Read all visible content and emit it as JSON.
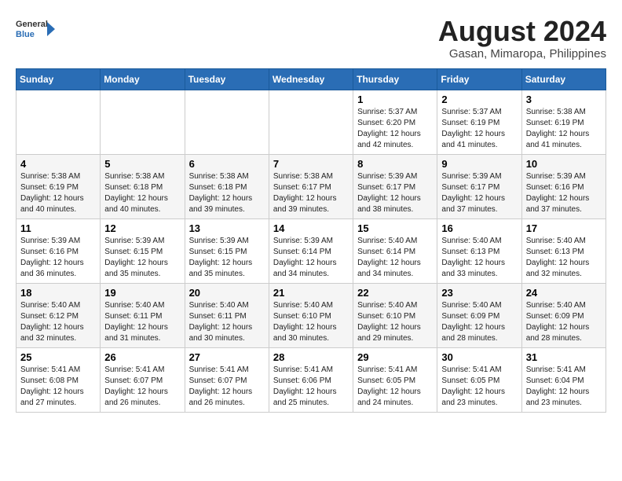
{
  "header": {
    "logo_general": "General",
    "logo_blue": "Blue",
    "month": "August 2024",
    "location": "Gasan, Mimaropa, Philippines"
  },
  "weekdays": [
    "Sunday",
    "Monday",
    "Tuesday",
    "Wednesday",
    "Thursday",
    "Friday",
    "Saturday"
  ],
  "weeks": [
    [
      {
        "day": "",
        "info": ""
      },
      {
        "day": "",
        "info": ""
      },
      {
        "day": "",
        "info": ""
      },
      {
        "day": "",
        "info": ""
      },
      {
        "day": "1",
        "info": "Sunrise: 5:37 AM\nSunset: 6:20 PM\nDaylight: 12 hours\nand 42 minutes."
      },
      {
        "day": "2",
        "info": "Sunrise: 5:37 AM\nSunset: 6:19 PM\nDaylight: 12 hours\nand 41 minutes."
      },
      {
        "day": "3",
        "info": "Sunrise: 5:38 AM\nSunset: 6:19 PM\nDaylight: 12 hours\nand 41 minutes."
      }
    ],
    [
      {
        "day": "4",
        "info": "Sunrise: 5:38 AM\nSunset: 6:19 PM\nDaylight: 12 hours\nand 40 minutes."
      },
      {
        "day": "5",
        "info": "Sunrise: 5:38 AM\nSunset: 6:18 PM\nDaylight: 12 hours\nand 40 minutes."
      },
      {
        "day": "6",
        "info": "Sunrise: 5:38 AM\nSunset: 6:18 PM\nDaylight: 12 hours\nand 39 minutes."
      },
      {
        "day": "7",
        "info": "Sunrise: 5:38 AM\nSunset: 6:17 PM\nDaylight: 12 hours\nand 39 minutes."
      },
      {
        "day": "8",
        "info": "Sunrise: 5:39 AM\nSunset: 6:17 PM\nDaylight: 12 hours\nand 38 minutes."
      },
      {
        "day": "9",
        "info": "Sunrise: 5:39 AM\nSunset: 6:17 PM\nDaylight: 12 hours\nand 37 minutes."
      },
      {
        "day": "10",
        "info": "Sunrise: 5:39 AM\nSunset: 6:16 PM\nDaylight: 12 hours\nand 37 minutes."
      }
    ],
    [
      {
        "day": "11",
        "info": "Sunrise: 5:39 AM\nSunset: 6:16 PM\nDaylight: 12 hours\nand 36 minutes."
      },
      {
        "day": "12",
        "info": "Sunrise: 5:39 AM\nSunset: 6:15 PM\nDaylight: 12 hours\nand 35 minutes."
      },
      {
        "day": "13",
        "info": "Sunrise: 5:39 AM\nSunset: 6:15 PM\nDaylight: 12 hours\nand 35 minutes."
      },
      {
        "day": "14",
        "info": "Sunrise: 5:39 AM\nSunset: 6:14 PM\nDaylight: 12 hours\nand 34 minutes."
      },
      {
        "day": "15",
        "info": "Sunrise: 5:40 AM\nSunset: 6:14 PM\nDaylight: 12 hours\nand 34 minutes."
      },
      {
        "day": "16",
        "info": "Sunrise: 5:40 AM\nSunset: 6:13 PM\nDaylight: 12 hours\nand 33 minutes."
      },
      {
        "day": "17",
        "info": "Sunrise: 5:40 AM\nSunset: 6:13 PM\nDaylight: 12 hours\nand 32 minutes."
      }
    ],
    [
      {
        "day": "18",
        "info": "Sunrise: 5:40 AM\nSunset: 6:12 PM\nDaylight: 12 hours\nand 32 minutes."
      },
      {
        "day": "19",
        "info": "Sunrise: 5:40 AM\nSunset: 6:11 PM\nDaylight: 12 hours\nand 31 minutes."
      },
      {
        "day": "20",
        "info": "Sunrise: 5:40 AM\nSunset: 6:11 PM\nDaylight: 12 hours\nand 30 minutes."
      },
      {
        "day": "21",
        "info": "Sunrise: 5:40 AM\nSunset: 6:10 PM\nDaylight: 12 hours\nand 30 minutes."
      },
      {
        "day": "22",
        "info": "Sunrise: 5:40 AM\nSunset: 6:10 PM\nDaylight: 12 hours\nand 29 minutes."
      },
      {
        "day": "23",
        "info": "Sunrise: 5:40 AM\nSunset: 6:09 PM\nDaylight: 12 hours\nand 28 minutes."
      },
      {
        "day": "24",
        "info": "Sunrise: 5:40 AM\nSunset: 6:09 PM\nDaylight: 12 hours\nand 28 minutes."
      }
    ],
    [
      {
        "day": "25",
        "info": "Sunrise: 5:41 AM\nSunset: 6:08 PM\nDaylight: 12 hours\nand 27 minutes."
      },
      {
        "day": "26",
        "info": "Sunrise: 5:41 AM\nSunset: 6:07 PM\nDaylight: 12 hours\nand 26 minutes."
      },
      {
        "day": "27",
        "info": "Sunrise: 5:41 AM\nSunset: 6:07 PM\nDaylight: 12 hours\nand 26 minutes."
      },
      {
        "day": "28",
        "info": "Sunrise: 5:41 AM\nSunset: 6:06 PM\nDaylight: 12 hours\nand 25 minutes."
      },
      {
        "day": "29",
        "info": "Sunrise: 5:41 AM\nSunset: 6:05 PM\nDaylight: 12 hours\nand 24 minutes."
      },
      {
        "day": "30",
        "info": "Sunrise: 5:41 AM\nSunset: 6:05 PM\nDaylight: 12 hours\nand 23 minutes."
      },
      {
        "day": "31",
        "info": "Sunrise: 5:41 AM\nSunset: 6:04 PM\nDaylight: 12 hours\nand 23 minutes."
      }
    ]
  ]
}
